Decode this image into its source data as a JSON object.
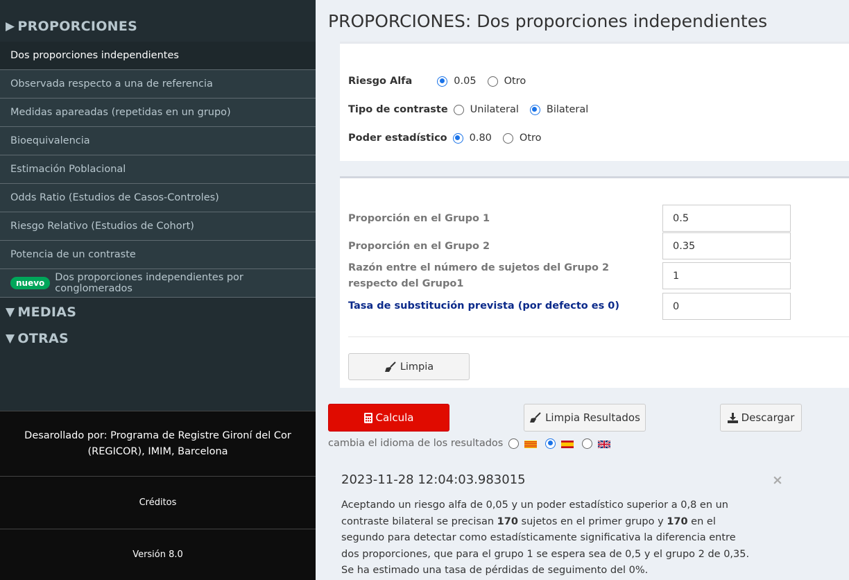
{
  "sidebar": {
    "sections": {
      "proporciones": "PROPORCIONES",
      "medias": "MEDIAS",
      "otras": "OTRAS"
    },
    "items": [
      {
        "label": "Dos proporciones independientes",
        "active": true
      },
      {
        "label": "Observada respecto a una de referencia"
      },
      {
        "label": "Medidas apareadas (repetidas en un grupo)"
      },
      {
        "label": "Bioequivalencia"
      },
      {
        "label": "Estimación Poblacional"
      },
      {
        "label": "Odds Ratio (Estudios de Casos-Controles)"
      },
      {
        "label": "Riesgo Relativo (Estudios de Cohort)"
      },
      {
        "label": "Potencia de un contraste"
      },
      {
        "label": "Dos proporciones independientes por conglomerados",
        "badge": "nuevo"
      }
    ],
    "footer": {
      "developed": "Desarollado por: Programa de Registre Gironí del Cor (REGICOR), IMIM, Barcelona",
      "credits": "Créditos",
      "version": "Versión 8.0"
    }
  },
  "main": {
    "title": "PROPORCIONES: Dos proporciones independientes",
    "params": {
      "alpha": {
        "label": "Riesgo Alfa",
        "opt1": "0.05",
        "opt2": "Otro",
        "selected": "0.05"
      },
      "contrast": {
        "label": "Tipo de contraste",
        "opt1": "Unilateral",
        "opt2": "Bilateral",
        "selected": "Bilateral"
      },
      "power": {
        "label": "Poder estadístico",
        "opt1": "0.80",
        "opt2": "Otro",
        "selected": "0.80"
      }
    },
    "fields": {
      "p1": {
        "label": "Proporción en el Grupo 1",
        "value": "0.5"
      },
      "p2": {
        "label": "Proporción en el Grupo 2",
        "value": "0.35"
      },
      "ratio": {
        "label": "Razón entre el número de sujetos del Grupo 2 respecto del Grupo1",
        "value": "1"
      },
      "loss": {
        "label": "Tasa de substitución prevista (por defecto es 0)",
        "value": "0"
      }
    },
    "buttons": {
      "limpia": "Limpia",
      "calcula": "Calcula",
      "limpia_resultados": "Limpia Resultados",
      "descargar": "Descargar"
    },
    "language": {
      "label": "cambia el idioma de los resultados",
      "selected": "es"
    },
    "result": {
      "timestamp": "2023-11-28 12:04:03.983015",
      "close": "×",
      "text_a": "Aceptando un riesgo alfa de 0,05 y un poder estadístico superior a 0,8 en un contraste bilateral se precisan ",
      "n1": "170",
      "text_b": " sujetos en el primer grupo y ",
      "n2": "170",
      "text_c": " en el segundo para detectar como estadísticamente significativa la diferencia entre dos proporciones, que para el grupo 1 se espera sea de 0,5 y el grupo 2 de 0,35. Se ha estimado una tasa de pérdidas de seguimento del 0%."
    }
  },
  "colors": {
    "sidebar_bg": "#222d32",
    "calcula_red": "#e00b00",
    "badge_green": "#00a65a",
    "radio_blue": "#1a73e8"
  }
}
